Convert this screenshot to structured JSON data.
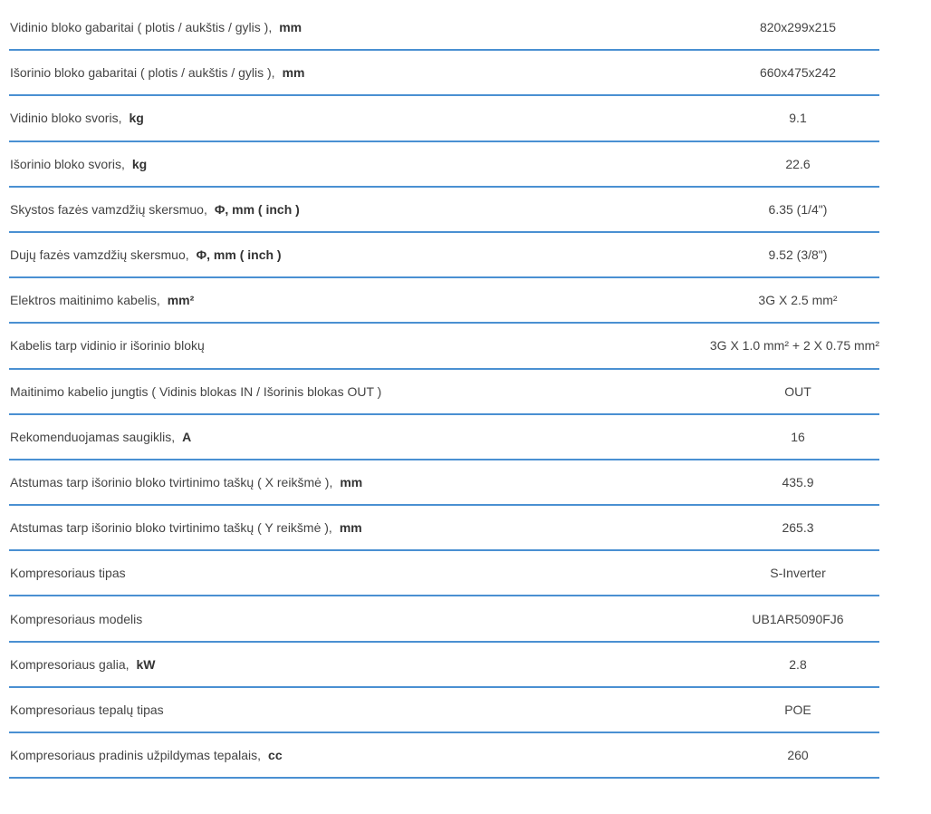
{
  "rows": [
    {
      "label": "Vidinio bloko gabaritai ( plotis / aukštis / gylis ),",
      "unit": "mm",
      "value": "820x299x215"
    },
    {
      "label": "Išorinio bloko gabaritai ( plotis / aukštis / gylis ),",
      "unit": "mm",
      "value": "660x475x242"
    },
    {
      "label": "Vidinio bloko svoris,",
      "unit": "kg",
      "value": "9.1"
    },
    {
      "label": "Išorinio bloko svoris,",
      "unit": "kg",
      "value": "22.6"
    },
    {
      "label": "Skystos fazės vamzdžių skersmuo,",
      "unit": "Φ, mm ( inch )",
      "value": "6.35 (1/4\")"
    },
    {
      "label": "Dujų fazės vamzdžių skersmuo,",
      "unit": "Φ, mm ( inch )",
      "value": "9.52 (3/8\")"
    },
    {
      "label": "Elektros maitinimo kabelis,",
      "unit": "mm²",
      "value": "3G X 2.5 mm²"
    },
    {
      "label": "Kabelis tarp vidinio ir išorinio blokų",
      "unit": "",
      "value": "3G X 1.0 mm² + 2 X 0.75 mm²"
    },
    {
      "label": "Maitinimo kabelio jungtis ( Vidinis blokas IN / Išorinis blokas OUT )",
      "unit": "",
      "value": "OUT"
    },
    {
      "label": "Rekomenduojamas saugiklis,",
      "unit": "A",
      "value": "16"
    },
    {
      "label": "Atstumas tarp išorinio bloko tvirtinimo taškų ( X reikšmė ),",
      "unit": "mm",
      "value": "435.9"
    },
    {
      "label": "Atstumas tarp išorinio bloko tvirtinimo taškų ( Y reikšmė ),",
      "unit": "mm",
      "value": "265.3"
    },
    {
      "label": "Kompresoriaus tipas",
      "unit": "",
      "value": "S-Inverter"
    },
    {
      "label": "Kompresoriaus modelis",
      "unit": "",
      "value": "UB1AR5090FJ6"
    },
    {
      "label": "Kompresoriaus galia,",
      "unit": "kW",
      "value": "2.8"
    },
    {
      "label": "Kompresoriaus tepalų tipas",
      "unit": "",
      "value": "POE"
    },
    {
      "label": "Kompresoriaus pradinis užpildymas tepalais,",
      "unit": "cc",
      "value": "260"
    }
  ],
  "colors": {
    "divider": "#4a90d2",
    "text": "#444444"
  }
}
